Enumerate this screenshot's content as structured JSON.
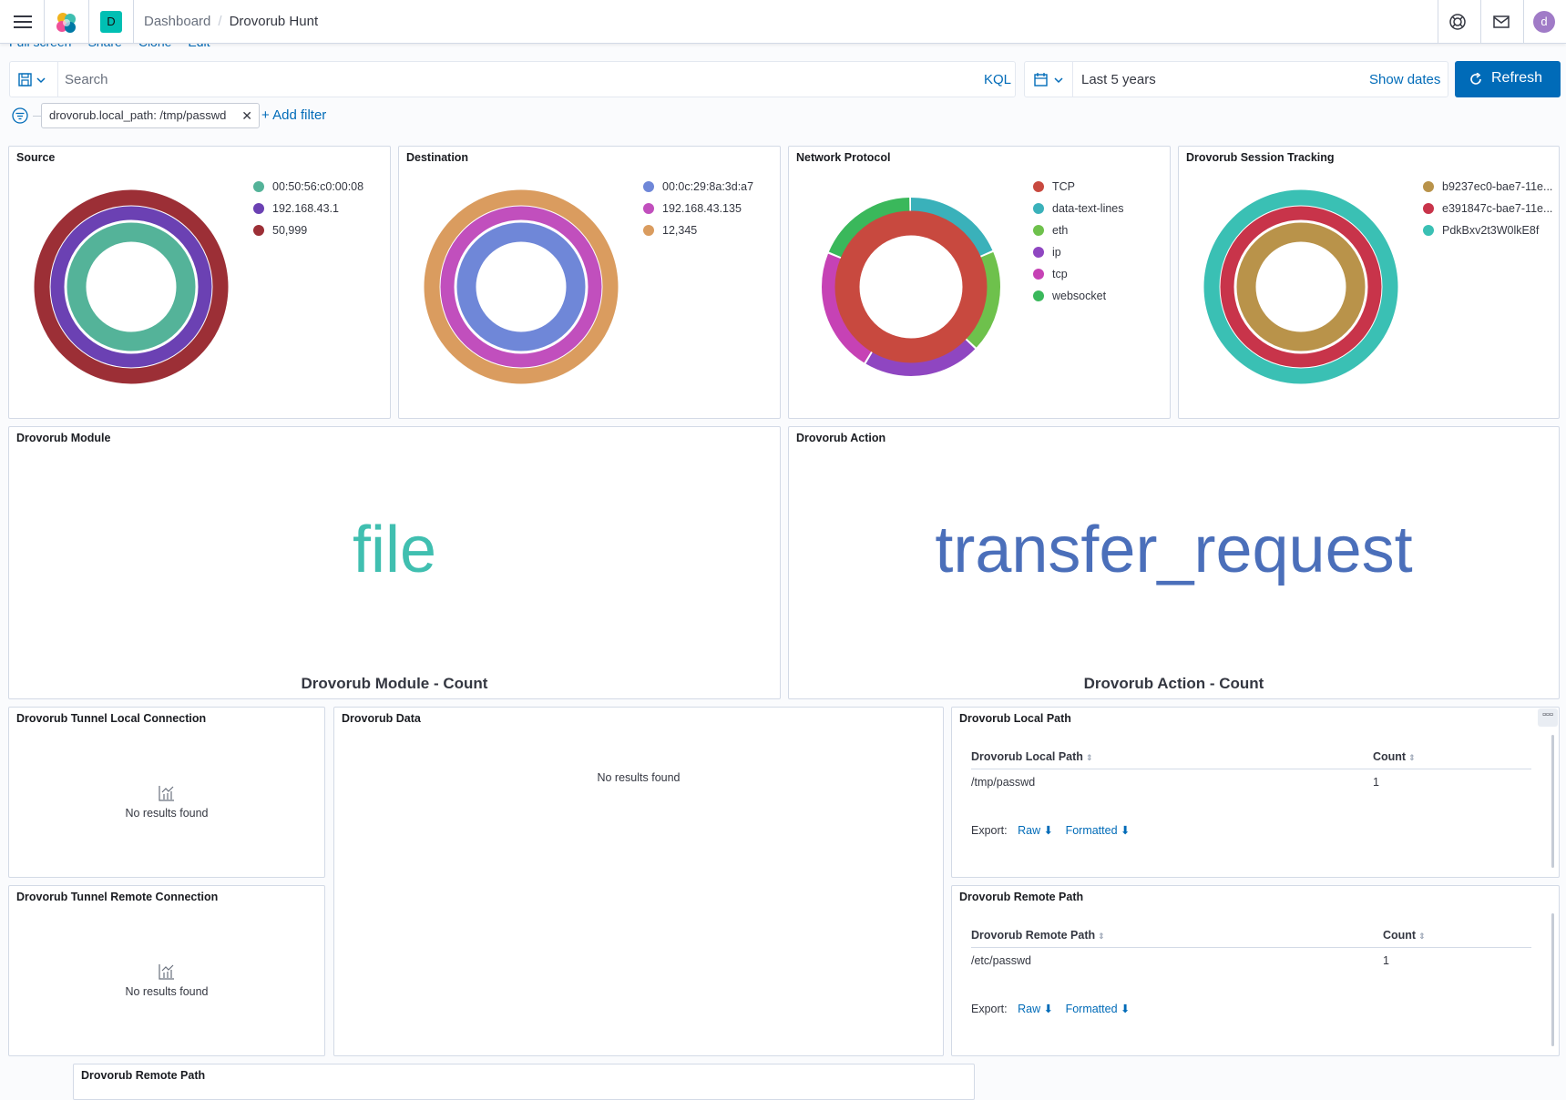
{
  "header": {
    "space_letter": "D",
    "breadcrumb_root": "Dashboard",
    "breadcrumb_current": "Drovorub Hunt",
    "avatar_letter": "d"
  },
  "dashboard_links": [
    "Full screen",
    "Share",
    "Clone",
    "Edit"
  ],
  "query": {
    "placeholder": "Search",
    "language": "KQL"
  },
  "time": {
    "range": "Last 5 years",
    "show_dates": "Show dates",
    "refresh": "Refresh"
  },
  "filters": {
    "active": [
      "drovorub.local_path: /tmp/passwd"
    ],
    "add_label": "+ Add filter"
  },
  "panels": {
    "source": {
      "title": "Source",
      "legend": [
        {
          "label": "00:50:56:c0:00:08",
          "color": "#54b399"
        },
        {
          "label": "192.168.43.1",
          "color": "#6b41b3"
        },
        {
          "label": "50,999",
          "color": "#9c2f36"
        }
      ]
    },
    "destination": {
      "title": "Destination",
      "legend": [
        {
          "label": "00:0c:29:8a:3d:a7",
          "color": "#6f87d8"
        },
        {
          "label": "192.168.43.135",
          "color": "#c14fbd"
        },
        {
          "label": "12,345",
          "color": "#da9c5f"
        }
      ]
    },
    "protocol": {
      "title": "Network Protocol",
      "legend": [
        {
          "label": "TCP",
          "color": "#c8493f"
        },
        {
          "label": "data-text-lines",
          "color": "#3ab1ba"
        },
        {
          "label": "eth",
          "color": "#6ec14c"
        },
        {
          "label": "ip",
          "color": "#8f46c1"
        },
        {
          "label": "tcp",
          "color": "#c642b5"
        },
        {
          "label": "websocket",
          "color": "#3ab85b"
        }
      ]
    },
    "session": {
      "title": "Drovorub Session Tracking",
      "legend": [
        {
          "label": "b9237ec0-bae7-11e...",
          "color": "#b9934a"
        },
        {
          "label": "e391847c-bae7-11e...",
          "color": "#c8344a"
        },
        {
          "label": "PdkBxv2t3W0lkE8f",
          "color": "#3ac0b4"
        }
      ]
    },
    "module": {
      "title": "Drovorub Module",
      "value": "file",
      "label": "Drovorub Module - Count",
      "color": "#40bfb0"
    },
    "action": {
      "title": "Drovorub Action",
      "value": "transfer_request",
      "label": "Drovorub Action - Count",
      "color": "#4b6fba"
    },
    "tunnel_local": {
      "title": "Drovorub Tunnel Local Connection",
      "empty": "No results found"
    },
    "tunnel_remote": {
      "title": "Drovorub Tunnel Remote Connection",
      "empty": "No results found"
    },
    "data": {
      "title": "Drovorub Data",
      "empty": "No results found"
    },
    "local_path": {
      "title": "Drovorub Local Path",
      "columns": [
        "Drovorub Local Path",
        "Count"
      ],
      "rows": [
        [
          "/tmp/passwd",
          "1"
        ]
      ],
      "export_label": "Export:",
      "raw": "Raw",
      "formatted": "Formatted",
      "menu": "▫▫▫"
    },
    "remote_path": {
      "title": "Drovorub Remote Path",
      "columns": [
        "Drovorub Remote Path",
        "Count"
      ],
      "rows": [
        [
          "/etc/passwd",
          "1"
        ]
      ],
      "export_label": "Export:",
      "raw": "Raw",
      "formatted": "Formatted"
    },
    "remote_path_2": {
      "title": "Drovorub Remote Path"
    }
  }
}
